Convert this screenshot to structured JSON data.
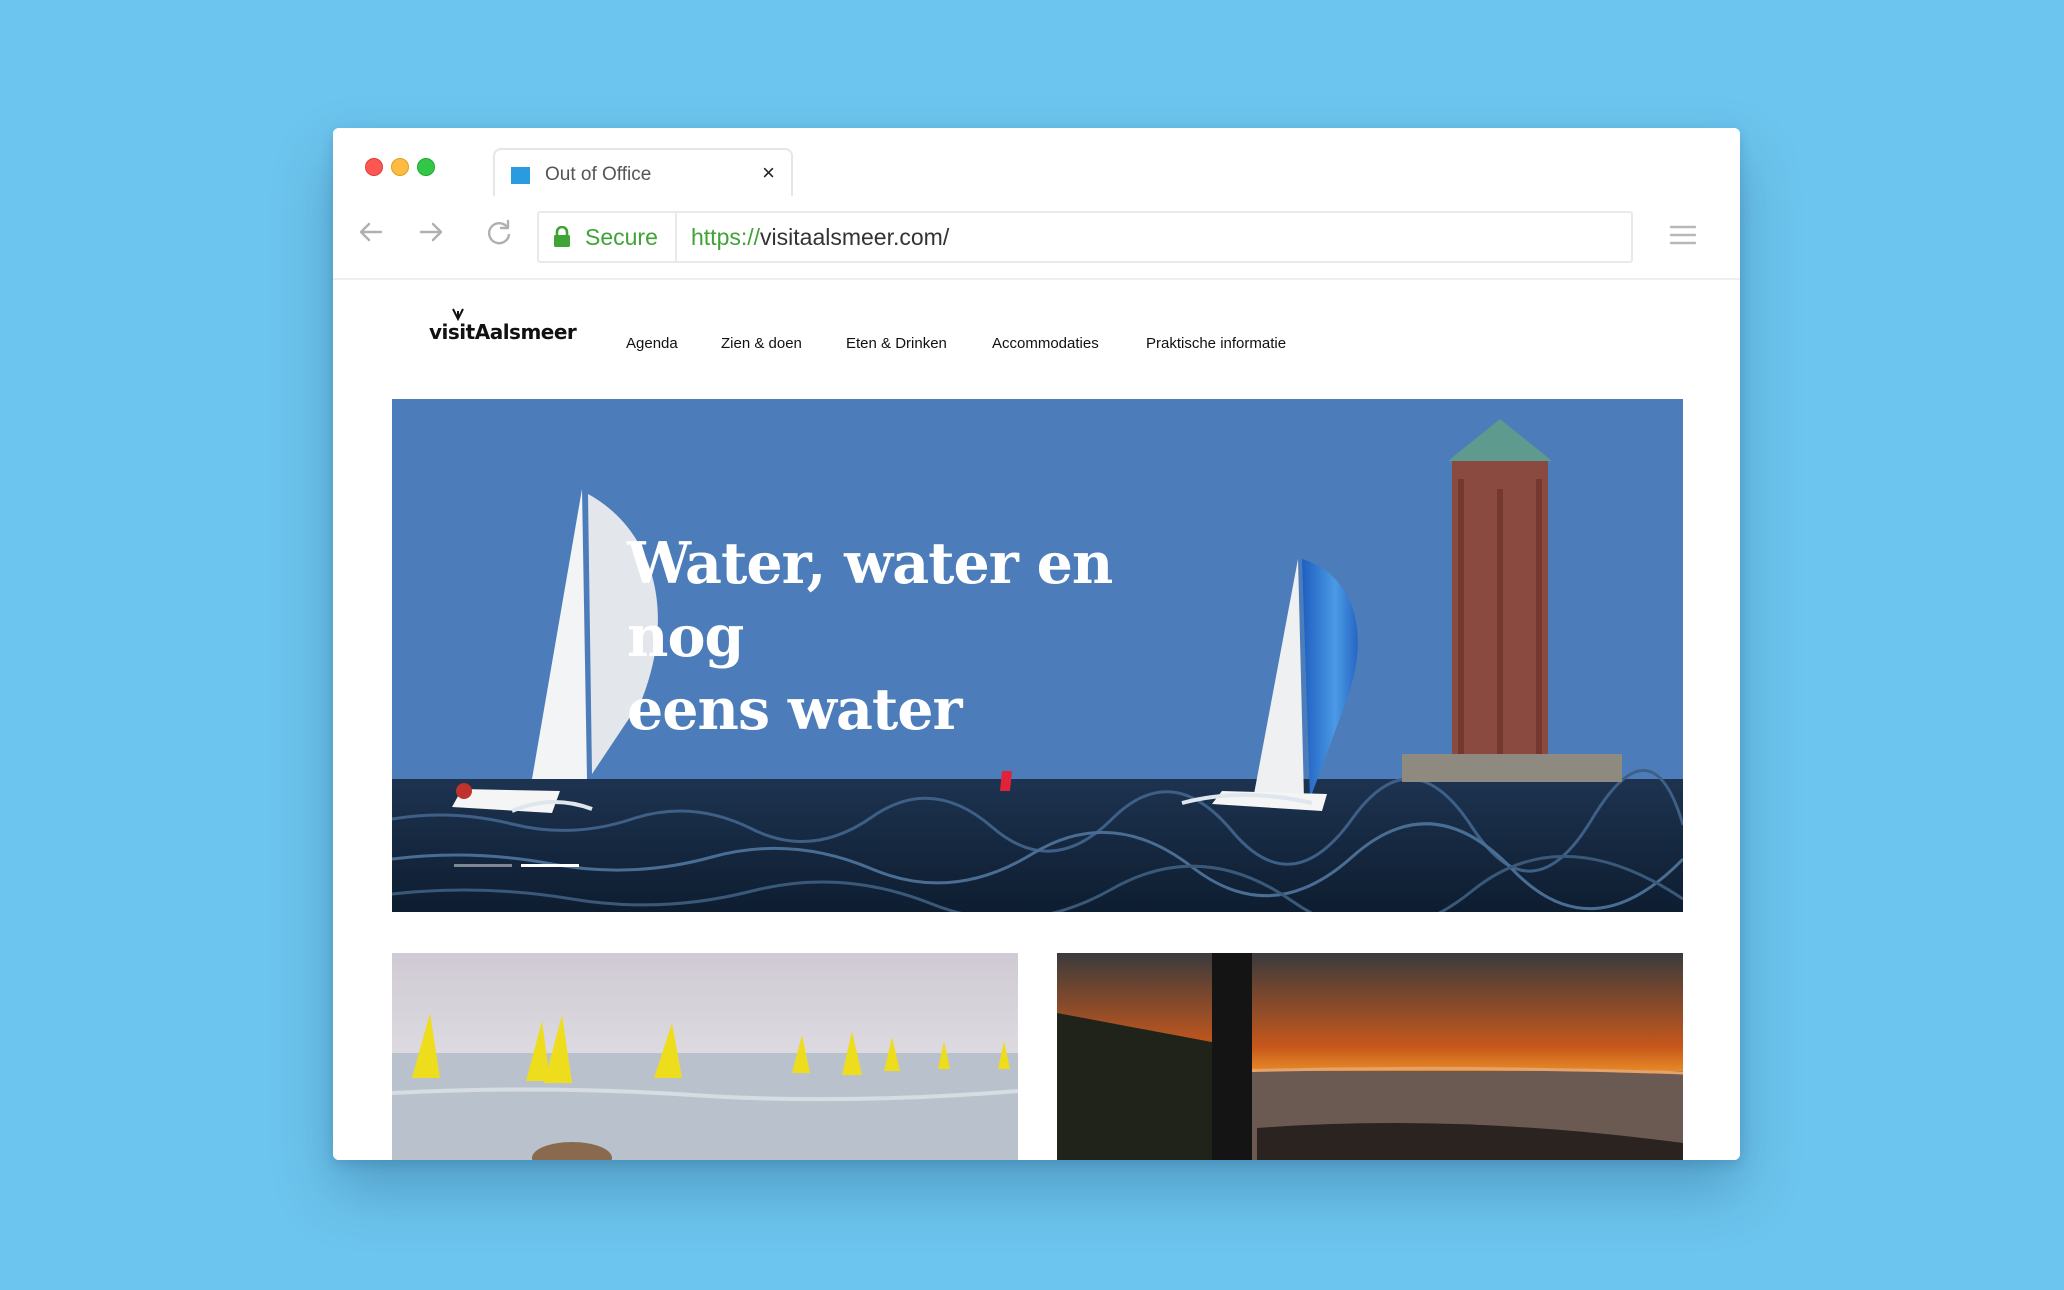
{
  "browser": {
    "tab": {
      "title": "Out of Office",
      "close_label": "×"
    },
    "address": {
      "secure_label": "Secure",
      "url_scheme": "https://",
      "url_rest": "visitaalsmeer.com/"
    }
  },
  "site": {
    "logo_text_1": "visit",
    "logo_text_2": "Aalsmeer",
    "nav": [
      {
        "label": "Agenda"
      },
      {
        "label": "Zien & doen"
      },
      {
        "label": "Eten & Drinken"
      },
      {
        "label": "Accommodaties"
      },
      {
        "label": "Praktische informatie"
      }
    ],
    "hero": {
      "title_line1": "Water, water en nog",
      "title_line2": "eens water",
      "slides_total": 2,
      "slide_active": 2
    }
  },
  "icons": {
    "back": "arrow-left-icon",
    "forward": "arrow-right-icon",
    "reload": "reload-icon",
    "lock": "lock-icon",
    "menu": "hamburger-menu-icon",
    "favicon": "favicon-icon"
  },
  "colors": {
    "background": "#6cc5ee",
    "secure_green": "#3fa335",
    "hero_sky": "#4c7dba",
    "favicon_blue": "#2b9be0"
  }
}
